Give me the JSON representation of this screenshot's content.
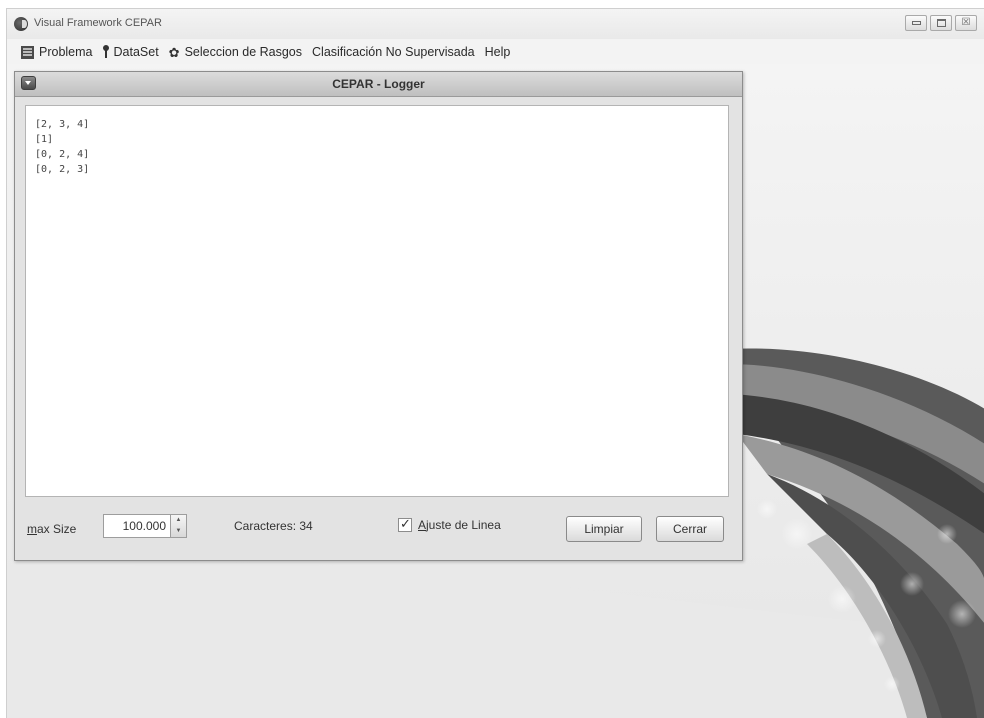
{
  "window": {
    "title": "Visual Framework CEPAR",
    "controls": {
      "minimize_icon": "minimize-icon",
      "maximize_icon": "maximize-icon",
      "close_glyph": "☒"
    }
  },
  "menu": {
    "items": [
      {
        "label": "Problema",
        "icon": "problem-icon"
      },
      {
        "label": "DataSet",
        "icon": "pin-icon"
      },
      {
        "label": "Seleccion de Rasgos",
        "icon": "gear-icon"
      },
      {
        "label": "Clasificación No Supervisada"
      },
      {
        "label": "Help"
      }
    ]
  },
  "logger": {
    "title": "CEPAR - Logger",
    "lines": [
      "[2, 3, 4]",
      "[1]",
      "[0, 2, 4]",
      "[0, 2, 3]"
    ],
    "max_size": {
      "label_first": "m",
      "label_rest": "ax Size",
      "value": "100.000"
    },
    "characters": "Caracteres: 34",
    "wrap": {
      "label_first": "A",
      "label_rest": "juste de Linea",
      "checked": true
    },
    "buttons": {
      "clear": "Limpiar",
      "close": "Cerrar"
    }
  },
  "colors": {
    "window_bg": "#f3f3f3",
    "swoosh_dark": "#3c3c3c",
    "swoosh_mid": "#8a8a8a",
    "swoosh_light": "#c8c8c8"
  }
}
